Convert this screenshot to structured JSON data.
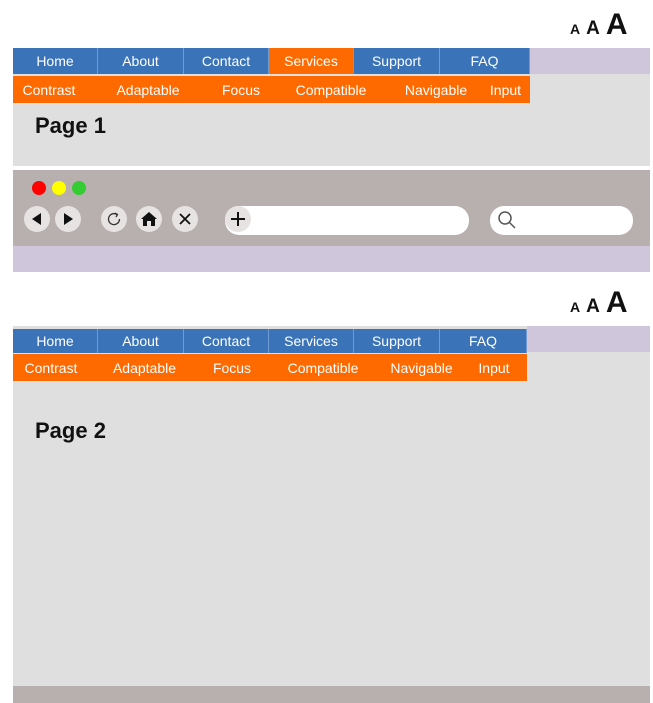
{
  "font_size_controls": [
    "A",
    "A",
    "A"
  ],
  "page1": {
    "title": "Page 1",
    "nav_primary": [
      "Home",
      "About",
      "Contact",
      "Services",
      "Support",
      "FAQ"
    ],
    "nav_secondary": [
      "Contrast",
      "Adaptable",
      "Focus",
      "Compatible",
      "Navigable",
      "Input"
    ],
    "active_item": "Services"
  },
  "page2": {
    "title": "Page 2",
    "nav_primary": [
      "Home",
      "About",
      "Contact",
      "Services",
      "Support",
      "FAQ"
    ],
    "nav_secondary": [
      "Contrast",
      "Adaptable",
      "Focus",
      "Compatible",
      "Navigable",
      "Input"
    ]
  },
  "browser": {
    "traffic_lights": [
      "#ff0000",
      "#ffff00",
      "#33cc33"
    ],
    "url_value": "",
    "search_value": ""
  },
  "colors": {
    "nav_blue": "#3a73b8",
    "nav_orange": "#ff6a00",
    "content_gray": "#dfdfdf",
    "chrome_gray": "#b8afaf",
    "lavender": "#cfc6dc"
  }
}
